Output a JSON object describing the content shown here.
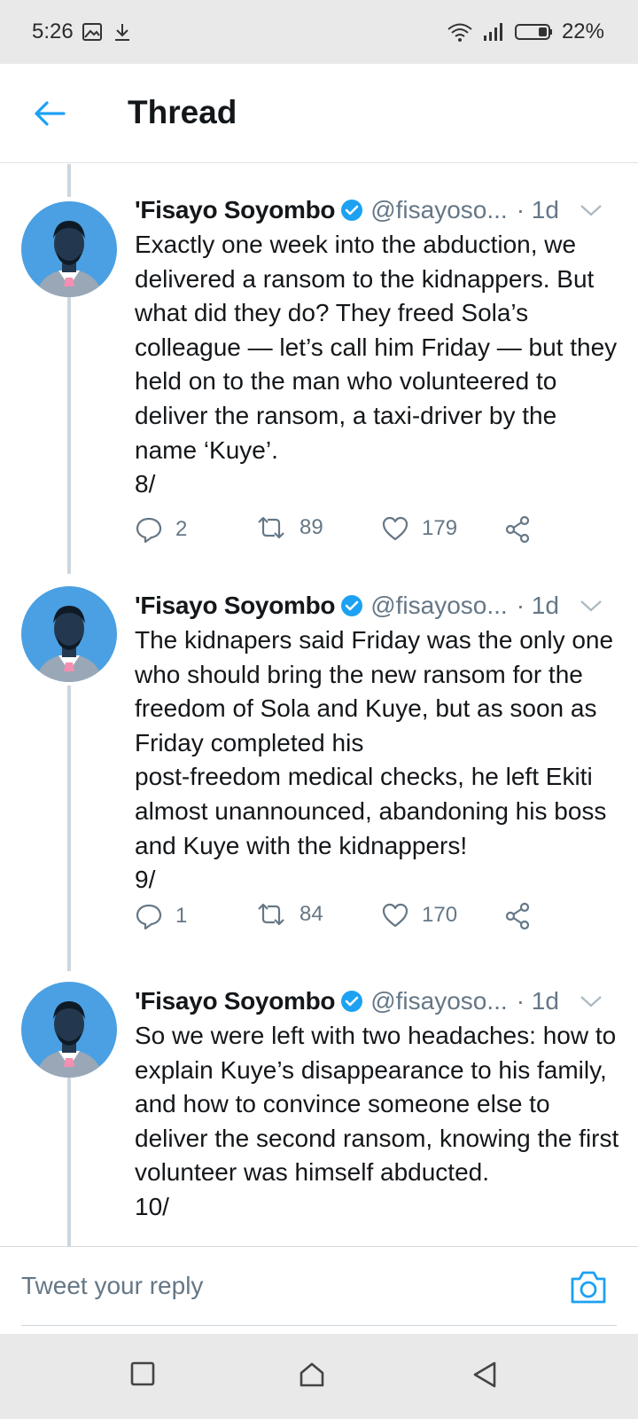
{
  "status_bar": {
    "time": "5:26",
    "battery": "22%"
  },
  "header": {
    "title": "Thread"
  },
  "tweets": [
    {
      "name": "'Fisayo Soyombo",
      "handle": "@fisayoso...",
      "time": "· 1d",
      "body": "Exactly one week into the abduction, we delivered a ransom to the kidnappers. But what did they do? They freed Sola’s colleague — let’s call him Friday — but they held on to the man who volunteered to deliver the ransom, a taxi-driver by the name ‘Kuye’.\n8/",
      "replies": "2",
      "retweets": "89",
      "likes": "179"
    },
    {
      "name": "'Fisayo Soyombo",
      "handle": "@fisayoso...",
      "time": "· 1d",
      "body": "The kidnapers said Friday was the only one who should bring the new ransom for the freedom of Sola and Kuye, but as soon as Friday completed his\npost-freedom medical checks, he left Ekiti almost unannounced, abandoning his boss and Kuye with the kidnappers!\n9/",
      "replies": "1",
      "retweets": "84",
      "likes": "170"
    },
    {
      "name": "'Fisayo Soyombo",
      "handle": "@fisayoso...",
      "time": "· 1d",
      "body": "So we were left with two headaches: how to explain Kuye’s disappearance to his family, and how to convince someone else to deliver the second ransom, knowing the first volunteer was himself abducted.\n10/"
    }
  ],
  "reply_bar": {
    "placeholder": "Tweet your reply"
  },
  "colors": {
    "accent": "#1da1f2",
    "secondary_text": "#657786",
    "avatar_bg": "#4aa0e2"
  },
  "icons": {
    "back": "arrow-left-icon",
    "verified": "verified-badge-icon",
    "caret": "chevron-down-icon",
    "reply": "reply-icon",
    "retweet": "retweet-icon",
    "like": "heart-icon",
    "share": "share-icon",
    "camera": "camera-icon"
  }
}
